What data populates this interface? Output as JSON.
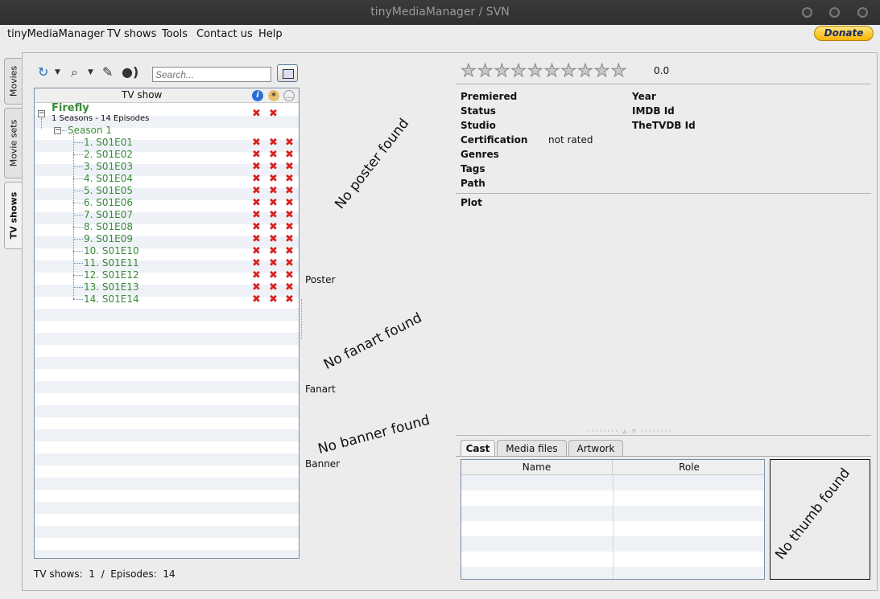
{
  "window": {
    "title": "tinyMediaManager / SVN"
  },
  "menu": {
    "items": [
      "tinyMediaManager",
      "TV shows",
      "Tools",
      "Contact us",
      "Help"
    ],
    "donate_label": "Donate"
  },
  "side_tabs": [
    "Movies",
    "Movie sets",
    "TV shows"
  ],
  "toolbar": {
    "search_placeholder": "Search...",
    "icons": [
      "refresh-icon",
      "search-icon",
      "edit-icon",
      "broadcast-icon",
      "filter-icon"
    ]
  },
  "tree": {
    "header": "TV show",
    "header_icons": [
      "info-icon",
      "artwork-icon",
      "subtitle-icon"
    ],
    "show": {
      "title": "Firefly",
      "subtitle": "1 Seasons - 14 Episodes",
      "season": "Season 1",
      "episodes": [
        "1. S01E01",
        "2. S01E02",
        "3. S01E03",
        "4. S01E04",
        "5. S01E05",
        "6. S01E06",
        "7. S01E07",
        "8. S01E08",
        "9. S01E09",
        "10. S01E10",
        "11. S01E11",
        "12. S01E12",
        "13. S01E13",
        "14. S01E14"
      ]
    },
    "mark": "✖"
  },
  "status": {
    "tvshows_label": "TV shows:",
    "tvshows_count": "1",
    "separator": "/",
    "episodes_label": "Episodes:",
    "episodes_count": "14"
  },
  "artwork": {
    "poster_missing": "No poster found",
    "poster_label": "Poster",
    "fanart_missing": "No fanart found",
    "fanart_label": "Fanart",
    "banner_missing": "No banner found",
    "banner_label": "Banner"
  },
  "details": {
    "rating": "0.0",
    "rating_stars_filled": 0,
    "rating_stars_total": 10,
    "premiered_label": "Premiered",
    "year_label": "Year",
    "status_label": "Status",
    "imdb_label": "IMDB Id",
    "studio_label": "Studio",
    "tvdb_label": "TheTVDB Id",
    "certification_label": "Certification",
    "certification_value": "not rated",
    "genres_label": "Genres",
    "tags_label": "Tags",
    "path_label": "Path",
    "plot_label": "Plot"
  },
  "bottom_tabs": [
    "Cast",
    "Media files",
    "Artwork"
  ],
  "cast_table": {
    "columns": [
      "Name",
      "Role"
    ]
  },
  "thumb": {
    "missing": "No thumb found"
  }
}
